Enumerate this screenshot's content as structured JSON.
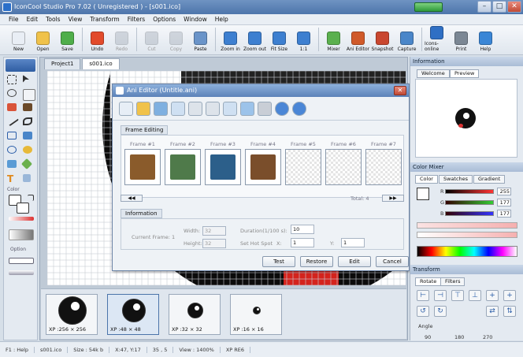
{
  "window": {
    "title": "IconCool Studio Pro 7.02 ( Unregistered ) - [s001.ico]"
  },
  "menu": [
    "File",
    "Edit",
    "Tools",
    "View",
    "Transform",
    "Filters",
    "Options",
    "Window",
    "Help"
  ],
  "toolbar": [
    {
      "label": "New",
      "icon": "new-file-icon",
      "color": "#e9eef5"
    },
    {
      "label": "Open",
      "icon": "open-folder-icon",
      "color": "#f0c24a"
    },
    {
      "label": "Save",
      "icon": "save-disk-icon",
      "color": "#4fae4a"
    },
    {
      "label": "Undo",
      "icon": "undo-icon",
      "color": "#e24b2b"
    },
    {
      "label": "Redo",
      "icon": "redo-icon",
      "color": "#9fa8b4",
      "disabled": true
    },
    {
      "label": "Cut",
      "icon": "cut-icon",
      "color": "#9fa8b4",
      "disabled": true
    },
    {
      "label": "Copy",
      "icon": "copy-icon",
      "color": "#9fa8b4",
      "disabled": true
    },
    {
      "label": "Paste",
      "icon": "paste-icon",
      "color": "#6a94c9"
    },
    {
      "label": "Zoom in",
      "icon": "zoom-in-icon",
      "color": "#3d7fd0"
    },
    {
      "label": "Zoom out",
      "icon": "zoom-out-icon",
      "color": "#3d7fd0"
    },
    {
      "label": "Fit Size",
      "icon": "fit-size-icon",
      "color": "#3d7fd0"
    },
    {
      "label": "1:1",
      "icon": "actual-size-icon",
      "color": "#3d7fd0"
    },
    {
      "label": "Mixer",
      "icon": "mixer-icon",
      "color": "#5bb04e"
    },
    {
      "label": "Ani Editor",
      "icon": "ani-editor-icon",
      "color": "#d05a2a"
    },
    {
      "label": "Snapshot",
      "icon": "snapshot-camera-icon",
      "color": "#c9472f"
    },
    {
      "label": "Capture",
      "icon": "capture-icon",
      "color": "#4a86c9"
    },
    {
      "label": "Icons-online",
      "icon": "icons-online-icon",
      "color": "#2f6fc4"
    },
    {
      "label": "Print",
      "icon": "print-icon",
      "color": "#7b8794"
    },
    {
      "label": "Help",
      "icon": "help-icon",
      "color": "#3a86d6"
    }
  ],
  "left": {
    "color_label": "Color",
    "option_label": "Option"
  },
  "doc_tabs": [
    "Project1",
    "s001.ico"
  ],
  "thumbs": [
    {
      "caption": "XP :256 × 256",
      "size": 36
    },
    {
      "caption": "XP :48 × 48",
      "size": 30,
      "selected": true
    },
    {
      "caption": "XP :32 × 32",
      "size": 20
    },
    {
      "caption": "XP :16 × 16",
      "size": 10
    }
  ],
  "dialog": {
    "title": "Ani Editor (Untitle.ani)",
    "frame_editing": "Frame Editing",
    "frames": [
      {
        "label": "Frame #1",
        "color": "#8a5b2b"
      },
      {
        "label": "Frame #2",
        "color": "#4f7a4a"
      },
      {
        "label": "Frame #3",
        "color": "#2c5f8a"
      },
      {
        "label": "Frame #4",
        "color": "#7a4e2b"
      },
      {
        "label": "Frame #5",
        "color": ""
      },
      {
        "label": "Frame #6",
        "color": ""
      },
      {
        "label": "Frame #7",
        "color": ""
      }
    ],
    "total": "Total: 4",
    "information": "Information",
    "current_frame": "Current Frame: 1",
    "width_label": "Width:",
    "width_value": "32",
    "height_label": "Height:",
    "height_value": "32",
    "duration_label": "Duration(1/100 s):",
    "duration_value": "10",
    "hotspot_label": "Set Hot Spot",
    "x_label": "X:",
    "x_value": "1",
    "y_label": "Y:",
    "y_value": "1",
    "buttons": {
      "test": "Test",
      "restore": "Restore",
      "edit": "Edit",
      "cancel": "Cancel"
    }
  },
  "right": {
    "information": "Information",
    "info_tabs": [
      "Welcome",
      "Preview"
    ],
    "color_mixer": "Color Mixer",
    "color_tabs": [
      "Color",
      "Swatches",
      "Gradient"
    ],
    "r_label": "R",
    "r_value": "255",
    "g_label": "G",
    "g_value": "177",
    "b_label": "B",
    "b_value": "177",
    "transform": "Transform",
    "transform_tabs": [
      "Rotate",
      "Filters"
    ],
    "angle_label": "Angle",
    "angles": [
      "90",
      "180",
      "270"
    ]
  },
  "status": [
    "F1 : Help",
    "s001.ico",
    "Size : 54k b",
    "X:47, Y:17",
    "35 , 5",
    "View : 1400%",
    "XP RE6"
  ]
}
